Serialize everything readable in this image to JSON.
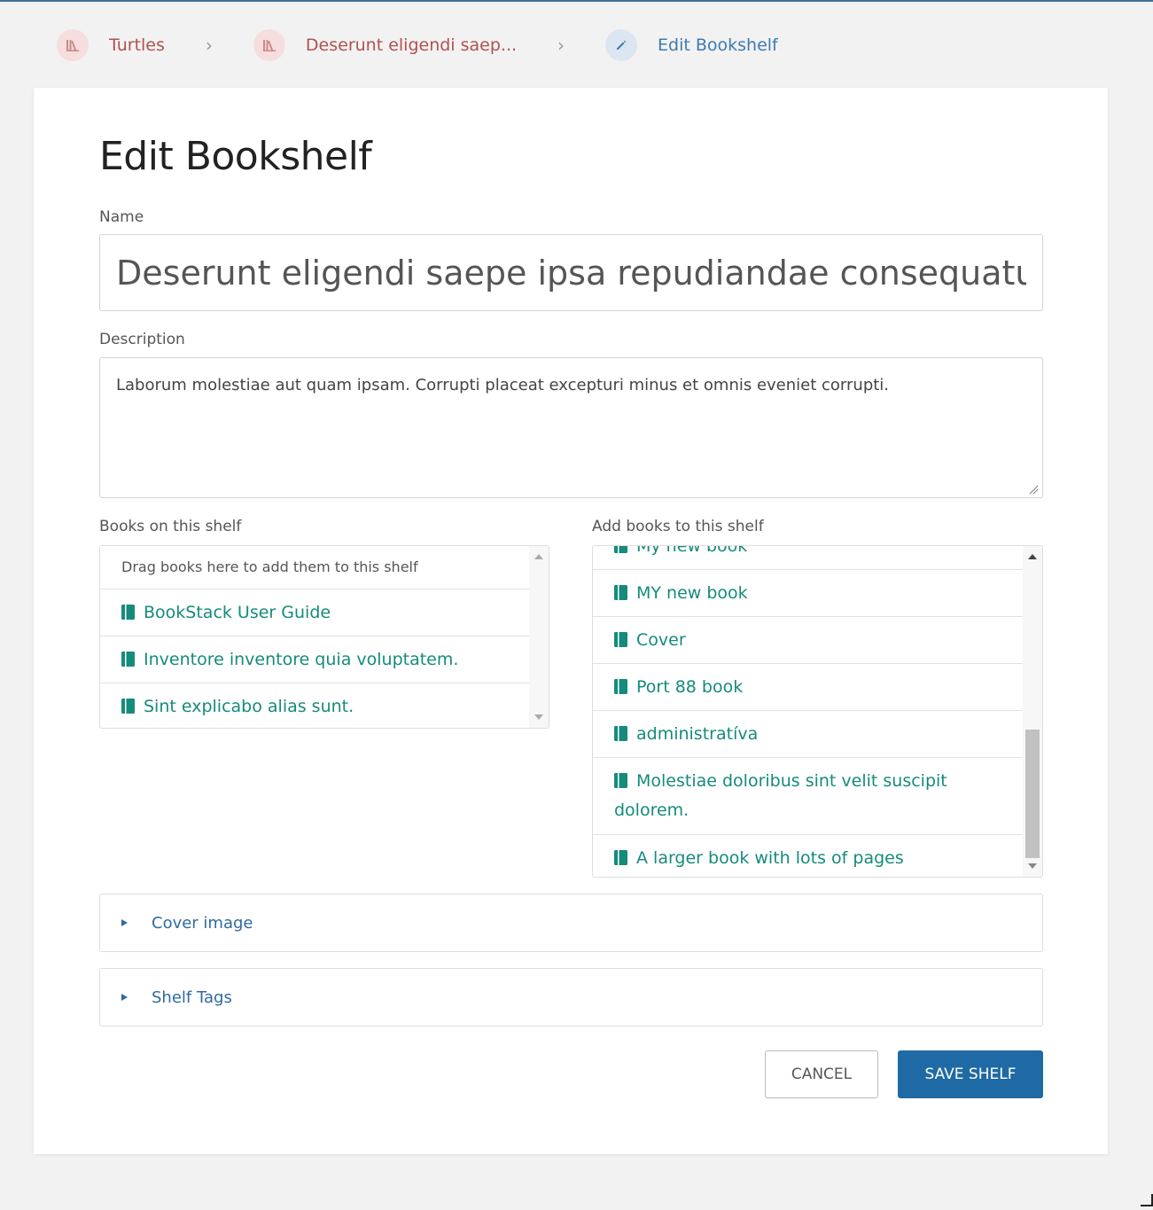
{
  "breadcrumbs": [
    {
      "label": "Turtles",
      "icon": "bookshelf-icon"
    },
    {
      "label": "Deserunt eligendi saep...",
      "icon": "bookshelf-icon"
    },
    {
      "label": "Edit Bookshelf",
      "icon": "pencil-icon"
    }
  ],
  "page": {
    "title": "Edit Bookshelf"
  },
  "form": {
    "name_label": "Name",
    "name_value": "Deserunt eligendi saepe ipsa repudiandae consequatur",
    "description_label": "Description",
    "description_value": "Laborum molestiae aut quam ipsam. Corrupti placeat excepturi minus et omnis eveniet corrupti."
  },
  "shelf_books": {
    "label": "Books on this shelf",
    "hint": "Drag books here to add them to this shelf",
    "items": [
      "BookStack User Guide",
      "Inventore inventore quia voluptatem.",
      "Sint explicabo alias sunt."
    ]
  },
  "available_books": {
    "label": "Add books to this shelf",
    "items": [
      "My new book",
      "MY new book",
      "Cover",
      "Port 88 book",
      "administratíva",
      "Molestiae doloribus sint velit suscipit dolorem.",
      "A larger book with lots of pages"
    ]
  },
  "sections": {
    "cover_image": "Cover image",
    "shelf_tags": "Shelf Tags"
  },
  "actions": {
    "cancel": "CANCEL",
    "save": "SAVE SHELF"
  },
  "colors": {
    "shelf": "#b0524f",
    "book": "#158b7b",
    "link": "#2f6aa0",
    "primary": "#1f6aa5"
  }
}
